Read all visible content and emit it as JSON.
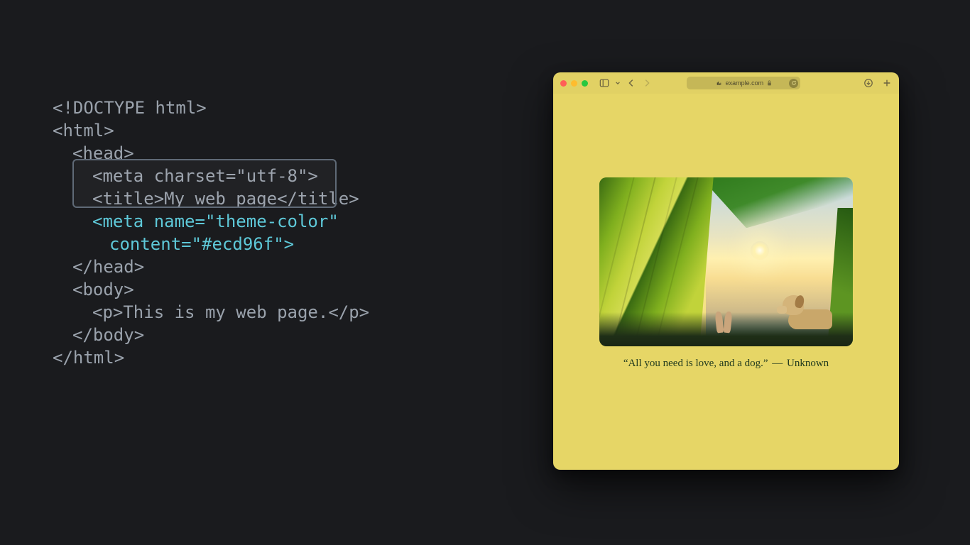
{
  "code": {
    "lines": [
      "<!DOCTYPE html>",
      "<html>",
      "  <head>",
      "    <meta charset=\"utf-8\">",
      "    <title>My web page</title>",
      "    <meta name=\"theme-color\"",
      "      content=\"#ecd96f\">",
      "  </head>",
      "  <body>",
      "    <p>This is my web page.</p>",
      "  </body>",
      "</html>"
    ],
    "l0": "<!DOCTYPE html>",
    "l1": "<html>",
    "l2": "<head>",
    "l3": "<meta charset=\"utf-8\">",
    "l4": "<title>My web page</title>",
    "l5": "<meta name=\"theme-color\"",
    "l6": "content=\"#ecd96f\">",
    "l7": "</head>",
    "l8": "<body>",
    "l9": "<p>This is my web page.</p>",
    "l10": "</body>",
    "l11": "</html>",
    "highlighted_theme_color": "#ecd96f"
  },
  "browser": {
    "url": "example.com",
    "theme_color": "#e6d666",
    "caption_quote": "“All you need is love, and a dog.”",
    "caption_separator": "—",
    "caption_attribution": "Unknown",
    "image_alt": "dog-in-tent-by-the-sea"
  }
}
